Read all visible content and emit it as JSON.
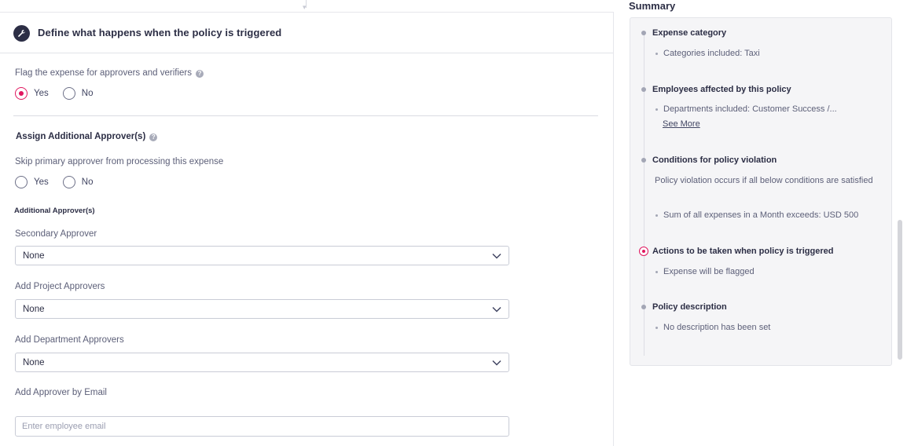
{
  "section": {
    "title": "Define what happens when the policy is triggered",
    "icon": "wrench-icon"
  },
  "flag": {
    "label": "Flag the expense for approvers and verifiers",
    "options": [
      "Yes",
      "No"
    ],
    "selected": "Yes"
  },
  "assign": {
    "title": "Assign Additional Approver(s)"
  },
  "skip": {
    "label": "Skip primary approver from processing this expense",
    "options": [
      "Yes",
      "No"
    ],
    "selected": null
  },
  "additional_approvers": {
    "title": "Additional Approver(s)",
    "secondary": {
      "label": "Secondary Approver",
      "value": "None"
    },
    "project": {
      "label": "Add Project Approvers",
      "value": "None"
    },
    "department": {
      "label": "Add Department Approvers",
      "value": "None"
    },
    "email": {
      "label": "Add Approver by Email",
      "placeholder": "Enter employee email",
      "value": ""
    }
  },
  "summary": {
    "title": "Summary",
    "expense_category": {
      "heading": "Expense category",
      "bullet": "Categories included: Taxi"
    },
    "employees": {
      "heading": "Employees affected by this policy",
      "bullet": "Departments included: Customer Success /...",
      "see_more": "See More"
    },
    "conditions": {
      "heading": "Conditions for policy violation",
      "description": "Policy violation occurs if all below conditions are satisfied",
      "bullet": "Sum of all expenses in a Month exceeds: USD 500"
    },
    "actions": {
      "heading": "Actions to be taken when policy is triggered",
      "bullet": "Expense will be flagged"
    },
    "policy_description": {
      "heading": "Policy description",
      "bullet": "No description has been set"
    }
  },
  "colors": {
    "accent": "#e0175f",
    "dark": "#2c2e45"
  }
}
